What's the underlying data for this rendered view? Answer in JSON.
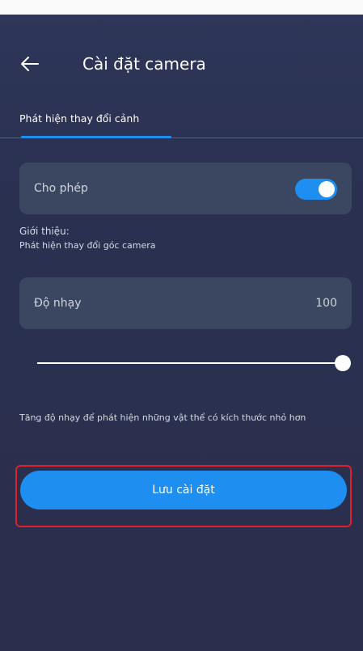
{
  "header": {
    "title": "Cài đặt camera",
    "back_icon": "arrow-left-icon"
  },
  "tabs": [
    {
      "label": "Phát hiện thay đổi cảnh",
      "active": true
    }
  ],
  "allow": {
    "label": "Cho phép",
    "enabled": true
  },
  "intro": {
    "label": "Giới thiệu:",
    "text": "Phát hiện thay đổi góc camera"
  },
  "sensitivity": {
    "label": "Độ nhạy",
    "value": "100",
    "slider_fraction": 1.0
  },
  "hint": "Tăng độ nhạy để phát hiện những vật thể có kích thước nhỏ hơn",
  "save_label": "Lưu cài đặt",
  "colors": {
    "accent": "#1e8ef0",
    "background": "#2a2f4d",
    "card": "#3b4660",
    "highlight_outline": "#e0202a"
  }
}
